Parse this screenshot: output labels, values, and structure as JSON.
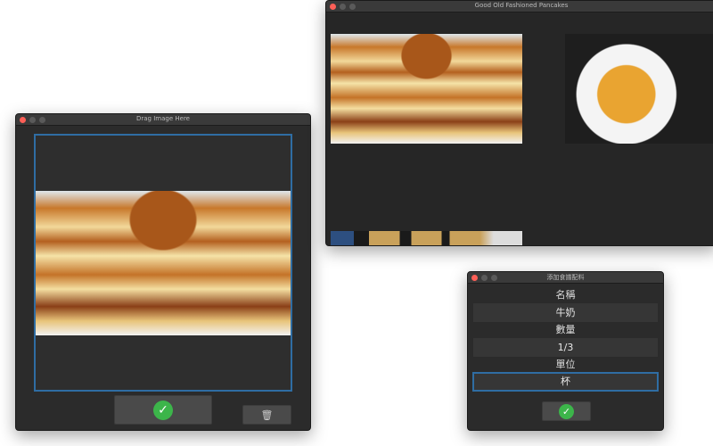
{
  "drop_window": {
    "title": "Drag Image Here",
    "confirm_icon": "check-circle-icon",
    "delete_icon": "trash-icon"
  },
  "recipe_window": {
    "title": "Good Old Fashioned Pancakes"
  },
  "ingredient_dialog": {
    "title": "添加食譜配料",
    "name_label": "名稱",
    "name_value": "牛奶",
    "quantity_label": "數量",
    "quantity_value": "1/3",
    "unit_label": "單位",
    "unit_value": "杯",
    "confirm_icon": "check-circle-icon"
  },
  "colors": {
    "accent": "#2f6da3",
    "confirm": "#3cb54a",
    "close": "#fe5f57"
  }
}
